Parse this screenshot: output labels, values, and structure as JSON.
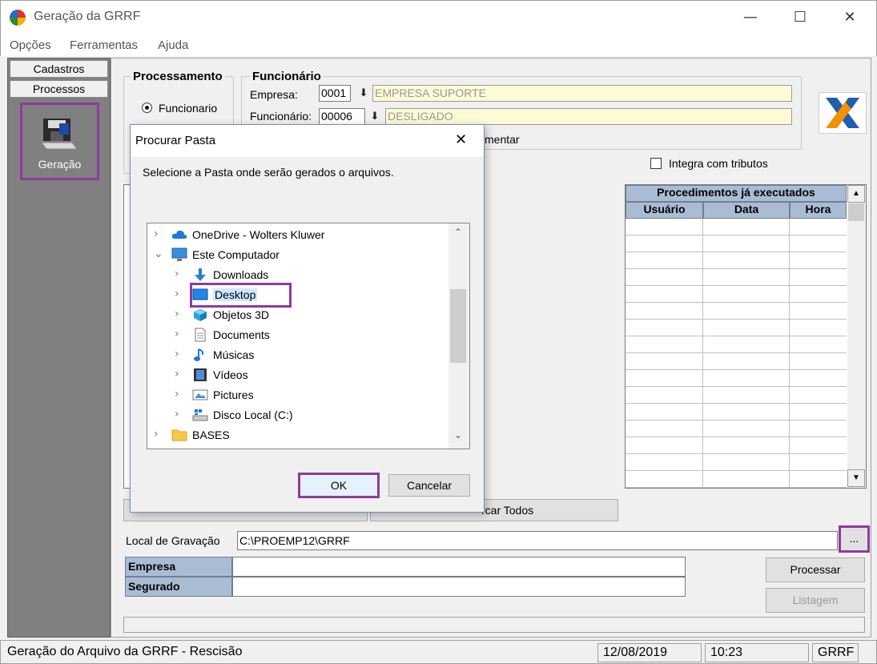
{
  "window": {
    "title": "Geração da GRRF",
    "minimize_glyph": "—",
    "maximize_glyph": "☐",
    "close_glyph": "✕"
  },
  "menu": [
    "Opções",
    "Ferramentas",
    "Ajuda"
  ],
  "left_panel": {
    "tabs": [
      "Cadastros",
      "Processos"
    ],
    "selected_item": "Geração"
  },
  "processamento": {
    "legend": "Processamento",
    "radio_label": "Funcionario"
  },
  "funcionario": {
    "legend": "Funcionário",
    "empresa_label": "Empresa:",
    "empresa_code": "0001",
    "empresa_name": "EMPRESA SUPORTE",
    "funcionario_label": "Funcionário:",
    "funcionario_code": "00006",
    "funcionario_name": "DESLIGADO",
    "complementar_partial": "mentar",
    "lookup_glyph": "⬇"
  },
  "integra_label": "Integra com tributos",
  "procedures": {
    "title": "Procedimentos já executados",
    "columns": [
      "Usuário",
      "Data",
      "Hora"
    ]
  },
  "bottom_buttons": {
    "marcar_partial": "rcar Todos"
  },
  "local_gravacao": {
    "label": "Local de Gravação",
    "value": "C:\\PROEMP12\\GRRF",
    "browse_label": "..."
  },
  "summary": {
    "empresa_label": "Empresa",
    "segurado_label": "Segurado"
  },
  "actions": {
    "processar": "Processar",
    "listagem": "Listagem"
  },
  "statusbar": {
    "message": "Geração do Arquivo da GRRF - Rescisão",
    "date": "12/08/2019",
    "time": "10:23",
    "module": "GRRF"
  },
  "dialog": {
    "title": "Procurar Pasta",
    "close_glyph": "✕",
    "instruction": "Selecione a Pasta onde serão gerados o arquivos.",
    "tree": [
      {
        "label": "OneDrive - Wolters Kluwer",
        "icon": "cloud-icon",
        "chevron": "›"
      },
      {
        "label": "Este Computador",
        "icon": "computer-icon",
        "chevron": "⌄"
      },
      {
        "label": "Downloads",
        "icon": "download-icon",
        "chevron": "›"
      },
      {
        "label": "Desktop",
        "icon": "desktop-icon",
        "chevron": "›",
        "selected": true
      },
      {
        "label": "Objetos 3D",
        "icon": "cube-icon",
        "chevron": "›"
      },
      {
        "label": "Documents",
        "icon": "document-icon",
        "chevron": "›"
      },
      {
        "label": "Músicas",
        "icon": "music-icon",
        "chevron": "›"
      },
      {
        "label": "Vídeos",
        "icon": "video-icon",
        "chevron": "›"
      },
      {
        "label": "Pictures",
        "icon": "picture-icon",
        "chevron": "›"
      },
      {
        "label": "Disco Local (C:)",
        "icon": "drive-icon",
        "chevron": "›"
      },
      {
        "label": "BASES",
        "icon": "folder-icon",
        "chevron": "›"
      }
    ],
    "ok_label": "OK",
    "cancel_label": "Cancelar"
  }
}
